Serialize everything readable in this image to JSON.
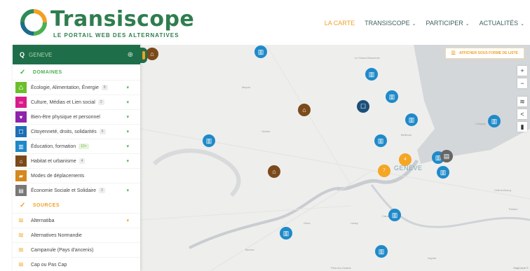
{
  "brand": {
    "title": "Transiscope",
    "subtitle": "LE PORTAIL WEB DES ALTERNATIVES"
  },
  "nav": [
    {
      "label": "LA CARTE",
      "caret": ""
    },
    {
      "label": "TRANSISCOPE",
      "caret": "⌄"
    },
    {
      "label": "PARTICIPER",
      "caret": "⌄"
    },
    {
      "label": "ACTUALITÉS",
      "caret": "⌄"
    }
  ],
  "search": {
    "value": "GENEVE"
  },
  "domains": {
    "heading": "DOMAINES",
    "items": [
      {
        "label": "Écologie, Alimentation, Énergie",
        "count": "8",
        "color": "#6bbf2a",
        "icon": "leaf-icon",
        "glyph": "♺"
      },
      {
        "label": "Culture, Médias et Lien social",
        "count": "2",
        "color": "#d81b8a",
        "icon": "link-icon",
        "glyph": "∞"
      },
      {
        "label": "Bien-être physique et personnel",
        "count": "",
        "color": "#8e24aa",
        "icon": "heart-icon",
        "glyph": "♥"
      },
      {
        "label": "Citoyenneté, droits, solidarités",
        "count": "6",
        "color": "#1e6fb5",
        "icon": "ballot-icon",
        "glyph": "☐"
      },
      {
        "label": "Éducation, formation",
        "count": "10+",
        "color": "#1e88c8",
        "icon": "school-icon",
        "glyph": "🏛"
      },
      {
        "label": "Habitat et urbanisme",
        "count": "4",
        "color": "#7a4a1a",
        "icon": "house-icon",
        "glyph": "⌂"
      },
      {
        "label": "Modes de déplacements",
        "count": "",
        "color": "#d4881e",
        "icon": "car-icon",
        "glyph": "🚗"
      },
      {
        "label": "Économie Sociale et Solidaire",
        "count": "3",
        "color": "#777777",
        "icon": "store-icon",
        "glyph": "▤"
      }
    ]
  },
  "sources": {
    "heading": "SOURCES",
    "items": [
      {
        "label": "Alternatiba"
      },
      {
        "label": "Alternatives Normandie"
      },
      {
        "label": "Campanule (Pays d'ancenis)"
      },
      {
        "label": "Cap ou Pas Cap"
      }
    ]
  },
  "map": {
    "show_list_label": "AFFICHER SOUS FORME DE LISTE",
    "city_label": "GENÈVE",
    "attribution": "MapCarte ©",
    "place_labels": [
      "Meyrin",
      "Vernier",
      "Le Grand-Saconnex",
      "Onex",
      "Lancy",
      "Carouge",
      "Chêne-Bourg",
      "Bernex",
      "Plan-les-Ouates",
      "Thônex",
      "Veyrier",
      "Bellevue",
      "Cologny"
    ],
    "clusters": [
      "4",
      "7"
    ],
    "controls": [
      "+",
      "−",
      "≋",
      "<",
      "▮"
    ]
  }
}
